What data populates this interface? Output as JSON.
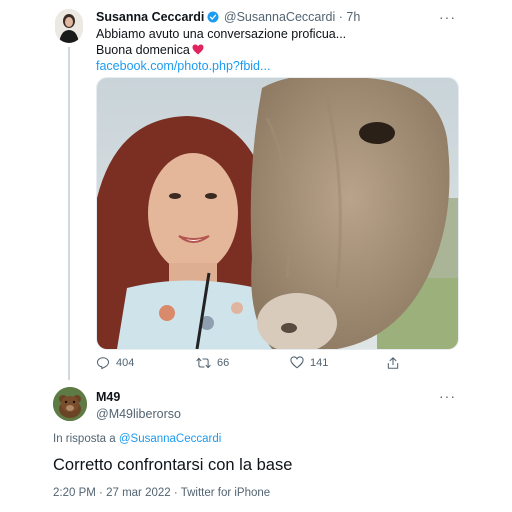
{
  "tweet": {
    "author_name": "Susanna Ceccardi",
    "handle": "@SusannaCeccardi",
    "separator": "·",
    "time": "7h",
    "more": "···",
    "text_line1": "Abbiamo avuto una conversazione proficua...",
    "text_line2": "Buona domenica",
    "link": "facebook.com/photo.php?fbid...",
    "heart_emoji_color": "#e0245e",
    "verified_color": "#1d9bf0",
    "replies": "404",
    "retweets": "66",
    "likes": "141"
  },
  "reply": {
    "author_name": "M49",
    "handle": "@M49liberorso",
    "more": "···",
    "in_reply_prefix": "In risposta a",
    "in_reply_handle": "@SusannaCeccardi",
    "text": "Corretto confrontarsi con la base",
    "time": "2:20 PM",
    "separator": "·",
    "date": "27 mar 2022",
    "source": "Twitter for iPhone"
  },
  "colors": {
    "accent": "#1d9bf0",
    "secondary_text": "#536471",
    "primary_text": "#0f1419"
  }
}
